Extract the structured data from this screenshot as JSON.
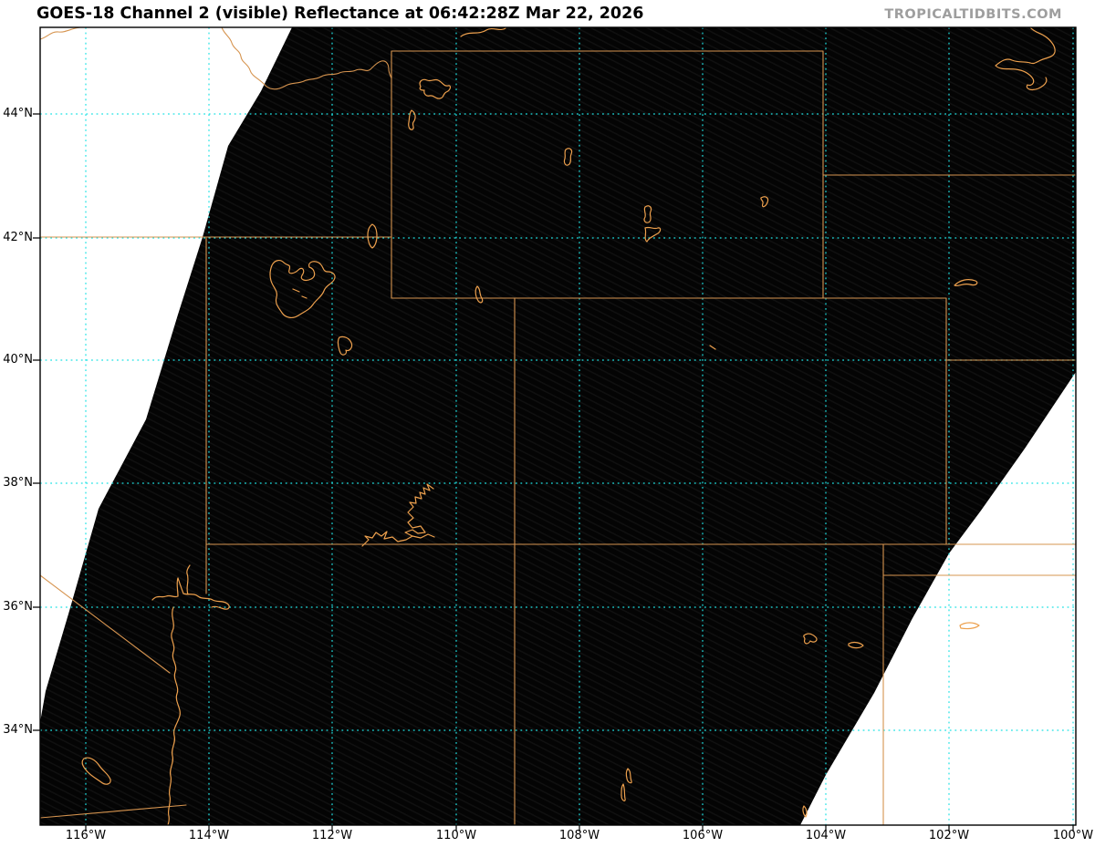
{
  "figure": {
    "title": "GOES-18 Channel 2 (visible) Reflectance at 06:42:28Z Mar 22, 2026",
    "watermark": "TROPICALTIDBITS.COM",
    "satellite": "GOES-18",
    "channel": "Channel 2 (visible)",
    "product": "Reflectance",
    "valid_time": "06:42:28Z Mar 22, 2026"
  },
  "map": {
    "x_axis": {
      "labels": [
        "116°W",
        "114°W",
        "112°W",
        "110°W",
        "108°W",
        "106°W",
        "104°W",
        "102°W",
        "100°W"
      ]
    },
    "y_axis": {
      "labels": [
        "44°N",
        "42°N",
        "40°N",
        "38°N",
        "36°N",
        "34°N"
      ]
    },
    "colors": {
      "graticule": "#1fe2e4",
      "border": "#d6944f",
      "water": "#eda04d",
      "data_fill": "#040404",
      "nodata_fill": "#ffffff",
      "label": "#000000",
      "watermark": "#9e9e9e"
    }
  }
}
